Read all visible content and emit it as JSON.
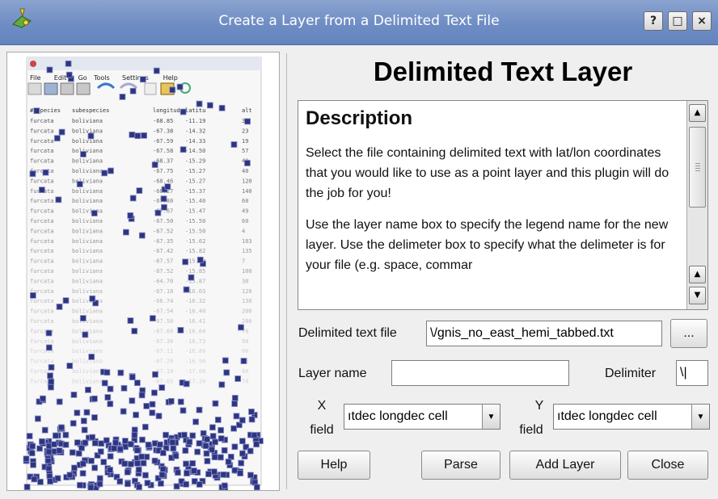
{
  "window": {
    "title": "Create a Layer from a Delimited Text File",
    "help_btn": "?",
    "maximize_glyph": "□",
    "close_glyph": "×"
  },
  "heading": "Delimited Text Layer",
  "description": {
    "title": "Description",
    "paragraphs": [
      "Select the file containing delimited text with lat/lon coordinates that you would like to use as a point layer and this plugin will do the job for you!",
      "Use the layer name box to specify the legend name for the new layer. Use the delimeter box to specify what the delimeter is for your file (e.g. space, commar"
    ],
    "scroll_up": "▲",
    "scroll_down": "▼"
  },
  "form": {
    "file_label": "Delimited text file",
    "file_value": "\\/gnis_no_east_hemi_tabbed.txt",
    "browse_label": "...",
    "layer_name_label": "Layer name",
    "layer_name_value": "",
    "delimiter_label": "Delimiter",
    "delimiter_value": "\\|",
    "x_label_top": "X",
    "x_label_bottom": "field",
    "x_value": "ıtdec longdec cell",
    "y_label_top": "Y",
    "y_label_bottom": "field",
    "y_value": "ıtdec longdec cell",
    "dropdown_arrow": "▼"
  },
  "buttons": {
    "help": "Help",
    "parse": "Parse",
    "add_layer": "Add Layer",
    "close": "Close"
  },
  "preview": {
    "menu": [
      "File",
      "Edit",
      "Go",
      "Tools",
      "Settings",
      "Help"
    ],
    "columns": [
      "#especies",
      "subespecies",
      "longitud",
      "latitu",
      "alt"
    ],
    "rows": [
      [
        "furcata",
        "boliviana",
        "-68.85",
        "-11.19",
        "32"
      ],
      [
        "furcata",
        "boliviana",
        "-67.38",
        "-14.32",
        "23"
      ],
      [
        "furcata",
        "boliviana",
        "-67.59",
        "-14.33",
        "19"
      ],
      [
        "furcata",
        "boliviana",
        "-67.58",
        "-14.50",
        "57"
      ],
      [
        "furcata",
        "boliviana",
        "-68.37",
        "-15.29",
        "49"
      ],
      [
        "furcata",
        "boliviana",
        "-67.75",
        "-15.27",
        "40"
      ],
      [
        "furcata",
        "boliviana",
        "-68.46",
        "-15.27",
        "120"
      ],
      [
        "furcata",
        "boliviana",
        "-68.27",
        "-15.37",
        "140"
      ],
      [
        "furcata",
        "boliviana",
        "-67.80",
        "-15.40",
        "60"
      ],
      [
        "furcata",
        "boliviana",
        "-67.67",
        "-15.47",
        "49"
      ],
      [
        "furcata",
        "boliviana",
        "-67.50",
        "-15.50",
        "60"
      ],
      [
        "furcata",
        "boliviana",
        "-67.52",
        "-15.50",
        "4"
      ],
      [
        "furcata",
        "boliviana",
        "-67.35",
        "-15.62",
        "103"
      ],
      [
        "furcata",
        "boliviana",
        "-67.42",
        "-15.82",
        "135"
      ],
      [
        "furcata",
        "boliviana",
        "-67.57",
        "-15.83",
        "7"
      ],
      [
        "furcata",
        "boliviana",
        "-67.52",
        "-15.85",
        "100"
      ],
      [
        "furcata",
        "boliviana",
        "-64.70",
        "-15.87",
        "30"
      ],
      [
        "furcata",
        "boliviana",
        "-67.18",
        "-16.03",
        "120"
      ],
      [
        "furcata",
        "boliviana",
        "-66.74",
        "-16.32",
        "130"
      ],
      [
        "furcata",
        "boliviana",
        "-67.54",
        "-16.40",
        "200"
      ],
      [
        "furcata",
        "boliviana",
        "-67.50",
        "-16.41",
        "200"
      ],
      [
        "furcata",
        "boliviana",
        "-67.60",
        "-16.64",
        "70"
      ],
      [
        "furcata",
        "boliviana",
        "-67.30",
        "-16.73",
        "98"
      ],
      [
        "furcata",
        "boliviana",
        "-67.11",
        "-16.80",
        "90"
      ],
      [
        "furcata",
        "boliviana",
        "-67.20",
        "-16.90",
        "60"
      ],
      [
        "furcata",
        "boliviana",
        "-67.10",
        "-17.00",
        "80"
      ],
      [
        "furcata",
        "boliviana",
        "-67.05",
        "-17.20",
        "70"
      ]
    ]
  },
  "colors": {
    "titlebar": "#7090c6",
    "dialog_bg": "#efefef",
    "marker": "#2e3580"
  }
}
